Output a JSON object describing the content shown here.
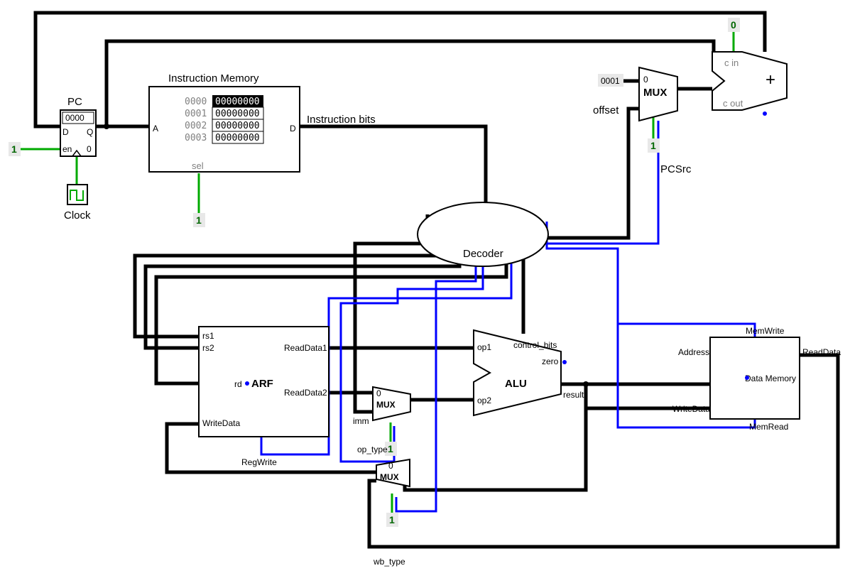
{
  "pc": {
    "title": "PC",
    "value": "0000",
    "d_label": "D",
    "q_label": "Q",
    "en_label": "en",
    "zero_label": "0",
    "en_val": "1"
  },
  "clock": {
    "label": "Clock"
  },
  "imem": {
    "title": "Instruction Memory",
    "a_label": "A",
    "d_label": "D",
    "sel_label": "sel",
    "sel_val": "1",
    "rows": [
      {
        "addr": "0000",
        "val": "00000000",
        "sel": true
      },
      {
        "addr": "0001",
        "val": "00000000",
        "sel": false
      },
      {
        "addr": "0002",
        "val": "00000000",
        "sel": false
      },
      {
        "addr": "0003",
        "val": "00000000",
        "sel": false
      }
    ],
    "out_label": "Instruction bits"
  },
  "decoder": {
    "label": "Decoder"
  },
  "arf": {
    "label": "ARF",
    "rs1": "rs1",
    "rs2": "rs2",
    "rd": "rd",
    "wd": "WriteData",
    "rd1": "ReadData1",
    "rd2": "ReadData2",
    "regwrite": "RegWrite"
  },
  "mux1": {
    "label": "MUX",
    "zero": "0",
    "val": "1",
    "imm": "imm",
    "op_type": "op_type"
  },
  "mux2": {
    "label": "MUX",
    "zero": "0",
    "val": "1",
    "wb_type": "wb_type"
  },
  "mux3": {
    "label": "MUX",
    "zero": "0",
    "val": "1",
    "in0": "0001",
    "in1": "offset",
    "pcsrc": "PCSrc"
  },
  "alu": {
    "label": "ALU",
    "op1": "op1",
    "op2": "op2",
    "ctrl": "control_bits",
    "zero": "zero",
    "result": "result"
  },
  "dmem": {
    "label": "Data Memory",
    "addr": "Address",
    "wd": "WriteData",
    "rd": "ReadData",
    "mw": "MemWrite",
    "mr": "MemRead"
  },
  "adder": {
    "cin_label": "c in",
    "cout_label": "c out",
    "cin_val": "0",
    "plus": "+"
  }
}
